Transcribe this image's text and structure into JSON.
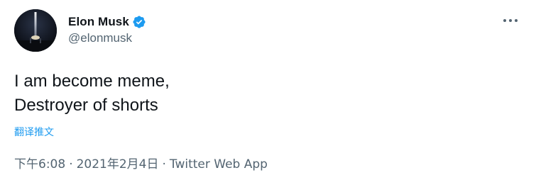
{
  "author": {
    "display_name": "Elon Musk",
    "handle": "@elonmusk",
    "verified": true,
    "verified_icon": "verified-badge-icon",
    "avatar": "rocket-launch-avatar"
  },
  "more_icon": "more-dots-icon",
  "tweet": {
    "lines": [
      "I am become meme,",
      "Destroyer of shorts"
    ],
    "translate_label": "翻译推文"
  },
  "meta": {
    "time": "下午6:08",
    "separator": "·",
    "date": "2021年2月4日",
    "source": "Twitter Web App"
  },
  "colors": {
    "accent": "#1d9bf0",
    "text": "#0f1419",
    "secondary": "#536471"
  }
}
